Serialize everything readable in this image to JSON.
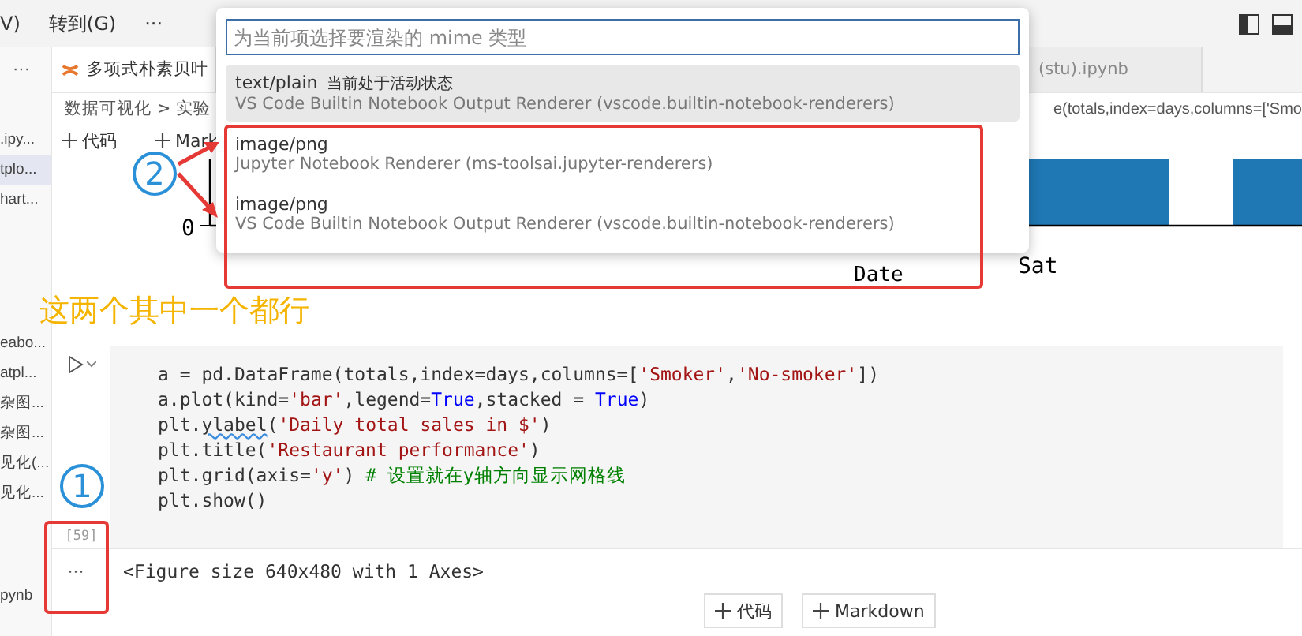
{
  "menu": {
    "items": [
      "V)",
      "转到(G)",
      "···"
    ]
  },
  "sidebar": {
    "more": "···",
    "items": [
      {
        "label": ".ipy...",
        "selected": false
      },
      {
        "label": "tplo...",
        "selected": true
      },
      {
        "label": "hart...",
        "selected": false
      },
      {
        "label": "eabo...",
        "selected": false
      },
      {
        "label": "atpl...",
        "selected": false
      },
      {
        "label": "杂图...",
        "selected": false
      },
      {
        "label": "杂图...",
        "selected": false
      },
      {
        "label": "见化(...",
        "selected": false
      },
      {
        "label": "见化...",
        "selected": false
      },
      {
        "label": "pynb",
        "selected": false
      }
    ]
  },
  "tabs": [
    {
      "label": "多项式朴素贝叶",
      "selected": true
    },
    {
      "label": "(stu).ipynb",
      "selected": false
    }
  ],
  "breadcrumb": {
    "path": "数据可视化 > 实验",
    "sticky_code": "e(totals,index=days,columns=['Smo"
  },
  "toolbar": {
    "buttons": [
      "代码",
      "Mark"
    ]
  },
  "chart": {
    "ytick": "0",
    "xtick": "Sat",
    "xlabel": "Date"
  },
  "quick_pick": {
    "placeholder": "为当前项选择要渲染的 mime 类型",
    "items": [
      {
        "mime": "text/plain",
        "note": "当前处于活动状态",
        "renderer": "VS Code Builtin Notebook Output Renderer (vscode.builtin-notebook-renderers)",
        "selected": true
      },
      {
        "mime": "image/png",
        "renderer": "Jupyter Notebook Renderer (ms-toolsai.jupyter-renderers)",
        "selected": false
      },
      {
        "mime": "image/png",
        "renderer": "VS Code Builtin Notebook Output Renderer (vscode.builtin-notebook-renderers)",
        "selected": false
      }
    ]
  },
  "annotations": {
    "note": "这两个其中一个都行",
    "circle_2": "2",
    "circle_1": "1"
  },
  "cell": {
    "execution_count": "[59]",
    "lines": [
      [
        {
          "text": "a = pd.DataFrame(totals,index=days,columns=[",
          "kind": "plain"
        },
        {
          "text": "'Smoker'",
          "kind": "string"
        },
        {
          "text": ",",
          "kind": "plain"
        },
        {
          "text": "'No-smoker'",
          "kind": "string"
        },
        {
          "text": "])",
          "kind": "plain"
        }
      ],
      [
        {
          "text": "a.plot(kind=",
          "kind": "plain"
        },
        {
          "text": "'bar'",
          "kind": "string"
        },
        {
          "text": ",legend=",
          "kind": "plain"
        },
        {
          "text": "True",
          "kind": "constant"
        },
        {
          "text": ",stacked = ",
          "kind": "plain"
        },
        {
          "text": "True",
          "kind": "constant"
        },
        {
          "text": ")",
          "kind": "plain"
        }
      ],
      [
        {
          "text": "plt.",
          "kind": "plain"
        },
        {
          "text": "ylabel",
          "kind": "warning"
        },
        {
          "text": "(",
          "kind": "plain"
        },
        {
          "text": "'Daily total sales in $'",
          "kind": "string"
        },
        {
          "text": ")",
          "kind": "plain"
        }
      ],
      [
        {
          "text": "plt.title(",
          "kind": "plain"
        },
        {
          "text": "'Restaurant performance'",
          "kind": "string"
        },
        {
          "text": ")",
          "kind": "plain"
        }
      ],
      [
        {
          "text": "plt.grid(axis=",
          "kind": "plain"
        },
        {
          "text": "'y'",
          "kind": "string"
        },
        {
          "text": ") ",
          "kind": "plain"
        },
        {
          "text": "# 设置就在y轴方向显示网格线",
          "kind": "comment"
        }
      ],
      [
        {
          "text": "plt.show()",
          "kind": "plain"
        }
      ]
    ],
    "output_more": "···",
    "output": "<Figure size 640x480 with 1 Axes>"
  },
  "add_buttons": [
    "代码",
    "Markdown"
  ]
}
